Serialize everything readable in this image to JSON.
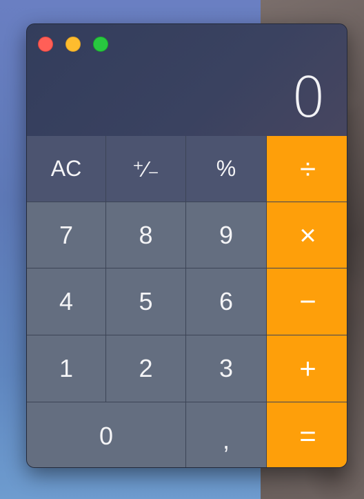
{
  "window": {
    "controls": {
      "close_color": "#ff5f57",
      "minimize_color": "#febc2e",
      "zoom_color": "#28c840"
    },
    "display_value": "0"
  },
  "keypad": {
    "row1": [
      "AC",
      "⁺∕₋",
      "%",
      "÷"
    ],
    "row2": [
      "7",
      "8",
      "9",
      "×"
    ],
    "row3": [
      "4",
      "5",
      "6",
      "−"
    ],
    "row4": [
      "1",
      "2",
      "3",
      "+"
    ],
    "row5": [
      "0",
      ",",
      "="
    ]
  },
  "colors": {
    "operator": "#fe9f0a",
    "function_key": "#4c5470",
    "number_key": "#646e80"
  }
}
